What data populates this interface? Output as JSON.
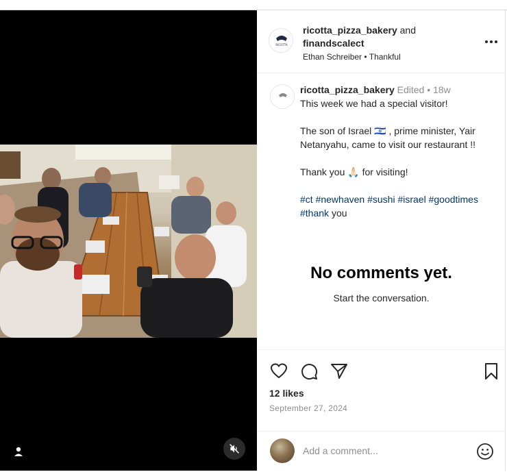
{
  "post": {
    "author": "ricotta_pizza_bakery",
    "joiner": "and",
    "collaborator": "finandscalect",
    "tagged_people": "Ethan Schreiber",
    "separator": "•",
    "audio": "Thankful",
    "avatar_text": "RICOTTA"
  },
  "caption": {
    "username": "ricotta_pizza_bakery",
    "edited": "Edited",
    "dot": "•",
    "age": "18w",
    "line1": "This week we had a special visitor!",
    "line2": "The son of Israel 🇮🇱 , prime minister, Yair Netanyahu, came to visit our restaurant !!",
    "line3_a": "Thank you",
    "line3_emoji": "🙏🏻",
    "line3_b": "for visiting!",
    "hashtags": [
      "#ct",
      "#newhaven",
      "#sushi",
      "#israel",
      "#goodtimes",
      "#thank"
    ],
    "trailing": "you"
  },
  "comments": {
    "empty_title": "No comments yet.",
    "empty_sub": "Start the conversation."
  },
  "actions": {
    "likes": "12 likes",
    "date": "September 27, 2024"
  },
  "comment_bar": {
    "placeholder": "Add a comment..."
  },
  "icons": {
    "more": "more-options-icon",
    "like": "heart-icon",
    "comment": "comment-icon",
    "share": "share-icon",
    "save": "bookmark-icon",
    "emoji": "emoji-icon",
    "user_tag": "user-tag-icon",
    "mute": "muted-speaker-icon"
  },
  "colors": {
    "text": "#262626",
    "secondary": "#8e8e8e",
    "hashtag": "#00376b",
    "media_bg": "#000000"
  }
}
